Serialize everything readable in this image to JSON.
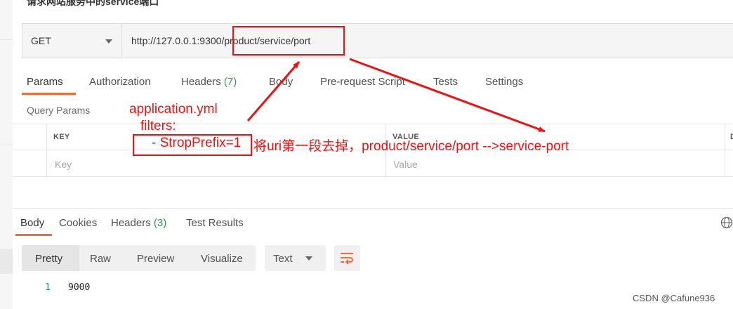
{
  "top_text": "请求网站服务中的service端口",
  "request": {
    "method": "GET",
    "url": "http://127.0.0.1:9300/product/service/port"
  },
  "request_tabs": {
    "params": "Params",
    "authorization": "Authorization",
    "headers": "Headers",
    "headers_count": "(7)",
    "body": "Body",
    "prerequest": "Pre-request Script",
    "tests": "Tests",
    "settings": "Settings"
  },
  "query_params": {
    "title": "Query Params",
    "columns": [
      "KEY",
      "VALUE",
      "D"
    ],
    "placeholders": {
      "key": "Key",
      "value": "Value"
    }
  },
  "response_tabs": {
    "body": "Body",
    "cookies": "Cookies",
    "headers": "Headers",
    "headers_count": "(3)",
    "test_results": "Test Results"
  },
  "response_view": {
    "modes": [
      "Pretty",
      "Raw",
      "Preview",
      "Visualize"
    ],
    "format": "Text"
  },
  "response_body": {
    "line_number": "1",
    "content": "9000"
  },
  "annotation": {
    "line1": "application.yml",
    "line2": "filters:",
    "line3": "- StropPrefix=1",
    "line4": "将uri第一段去掉，product/service/port  -->service-port",
    "color": "#ee1111"
  },
  "icons": {
    "method_dropdown": "chevron-down-icon",
    "globe": "globe-icon",
    "wrap": "wrap-lines-icon",
    "format_dropdown": "chevron-down-icon"
  },
  "watermark": "CSDN @Cafune936"
}
